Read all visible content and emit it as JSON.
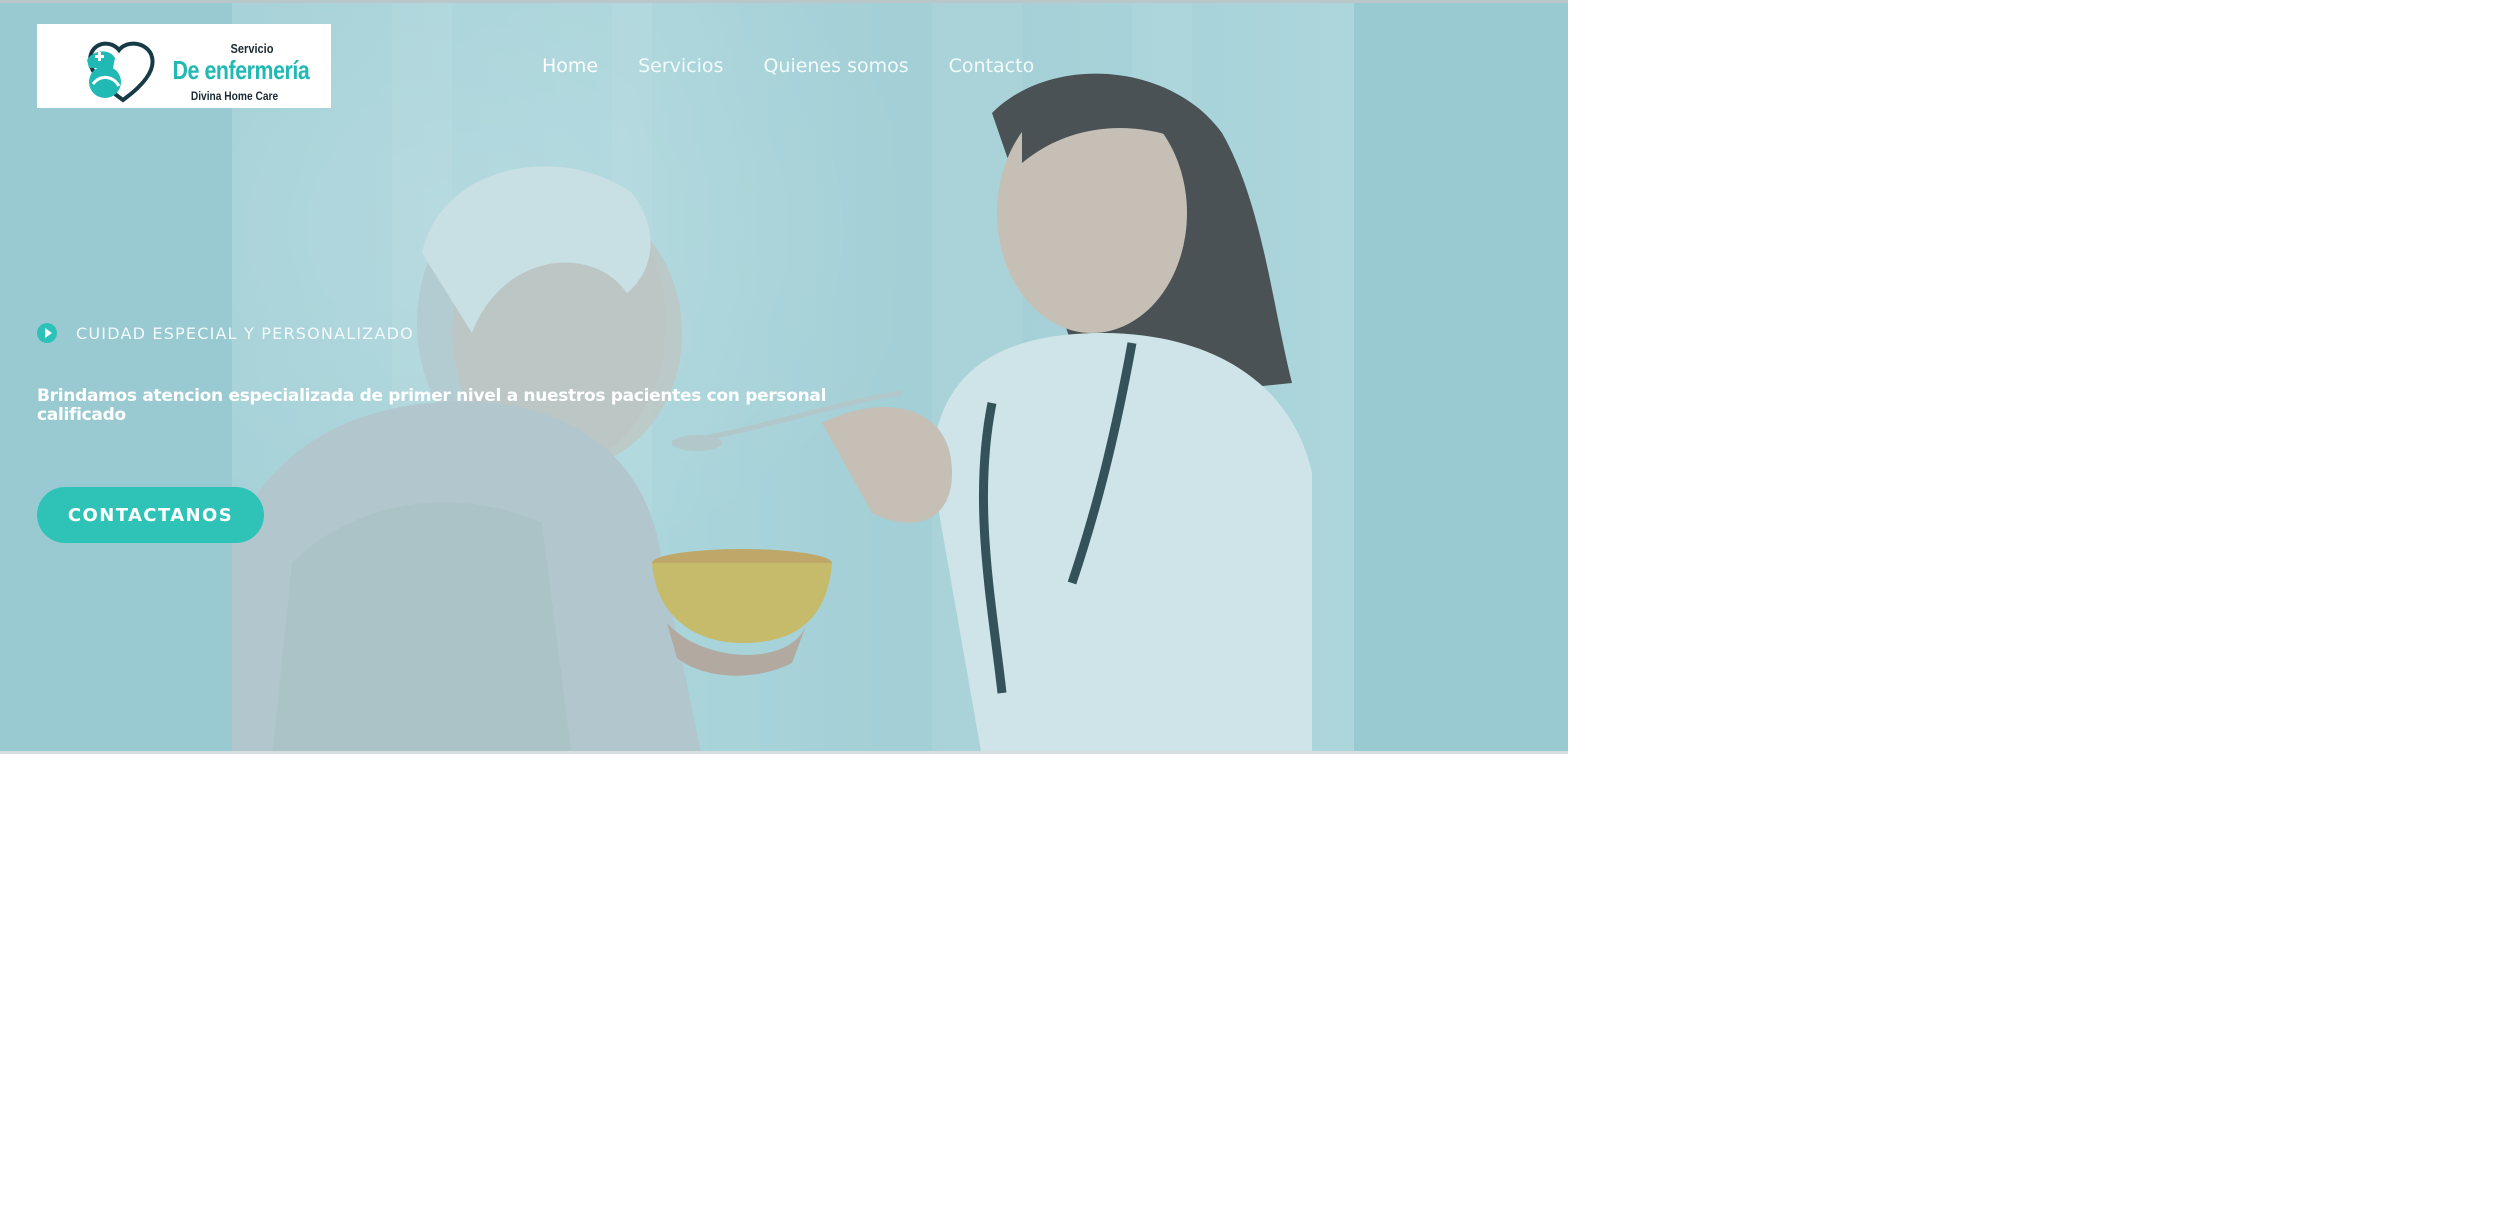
{
  "logo": {
    "line1": "Servicio",
    "line2": "De enfermería",
    "line3": "Divina Home Care",
    "icon": "nurse-heart-logo-icon"
  },
  "nav": {
    "items": [
      {
        "label": "Home",
        "active": true
      },
      {
        "label": "Servicios",
        "active": false
      },
      {
        "label": "Quienes somos",
        "active": false
      },
      {
        "label": "Contacto",
        "active": false
      }
    ]
  },
  "hero": {
    "eyebrow": "CUIDAD ESPECIAL Y PERSONALIZADO",
    "eyebrow_icon": "play-circle-icon",
    "headline": "Brindamos atencion especializada de primer nivel a nuestros pacientes con personal calificado",
    "cta_label": "CONTACTANOS",
    "image_description_icon": "hero-photo"
  },
  "colors": {
    "accent": "#2fc3b7",
    "background": "#a7d0d6",
    "logo_teal": "#20b9b4"
  }
}
